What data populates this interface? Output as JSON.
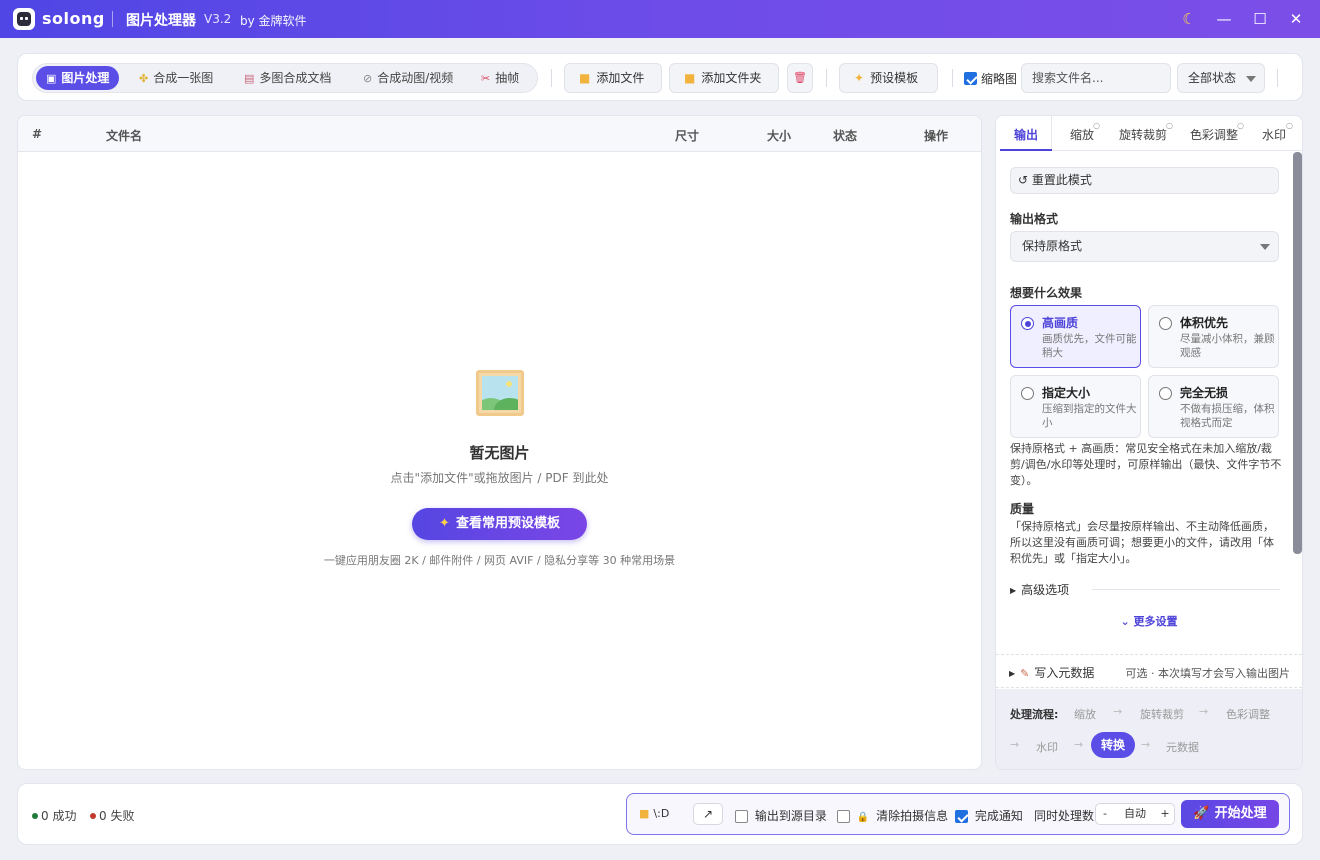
{
  "titlebar": {
    "app_name": "solong",
    "title": "图片处理器",
    "version": "V3.2",
    "by": "by 金牌软件",
    "theme_icon": "☾",
    "minimize_icon": "—",
    "maximize_icon": "☐",
    "close_icon": "✕"
  },
  "toolbar": {
    "mode_tabs": [
      {
        "label": "图片处理",
        "icon": "▣",
        "active": true
      },
      {
        "label": "合成一张图",
        "icon": "✤"
      },
      {
        "label": "多图合成文档",
        "icon": "▤"
      },
      {
        "label": "合成动图/视频",
        "icon": "⊘"
      },
      {
        "label": "抽帧",
        "icon": "✂"
      }
    ],
    "add_file": "添加文件",
    "add_folder": "添加文件夹",
    "delete_icon": "🗑",
    "folder_icon": "■",
    "preset_template": "预设模板",
    "preset_icon": "✦",
    "thumbnail_label": "缩略图",
    "thumbnail_checked": true,
    "search_placeholder": "搜索文件名...",
    "status_filter": "全部状态"
  },
  "table": {
    "columns": [
      "#",
      "文件名",
      "尺寸",
      "大小",
      "状态",
      "操作"
    ],
    "rows": [],
    "empty_title": "暂无图片",
    "empty_hint": "点击\"添加文件\"或拖放图片 / PDF 到此处",
    "preset_button": "查看常用预设模板",
    "preset_button_icon": "✦",
    "preset_sub": "一键应用朋友圈 2K / 邮件附件 / 网页 AVIF / 隐私分享等 30 种常用场景"
  },
  "side": {
    "tabs": [
      "输出",
      "缩放",
      "旋转裁剪",
      "色彩调整",
      "水印"
    ],
    "active_tab": "输出",
    "reset_label": "↺ 重置此模式",
    "output_format_label": "输出格式",
    "output_format_value": "保持原格式",
    "effect_label": "想要什么效果",
    "effects": [
      {
        "title": "高画质",
        "desc": "画质优先，文件可能稍大",
        "selected": true
      },
      {
        "title": "体积优先",
        "desc": "尽量减小体积，兼顾观感",
        "selected": false
      },
      {
        "title": "指定大小",
        "desc": "压缩到指定的文件大小",
        "selected": false
      },
      {
        "title": "完全无损",
        "desc": "不做有损压缩，体积视格式而定",
        "selected": false
      }
    ],
    "effect_note": "保持原格式 + 高画质：常见安全格式在未加入缩放/裁剪/调色/水印等处理时，可原样输出（最快、文件字节不变）。",
    "quality_label": "质量",
    "quality_note": "「保持原格式」会尽量按原样输出、不主动降低画质，所以这里没有画质可调；想要更小的文件，请改用「体积优先」或「指定大小」。",
    "advanced": "高级选项",
    "more_settings": "⌄ 更多设置",
    "metadata_title": "写入元数据",
    "metadata_hint": "可选 · 本次填写才会写入输出图片",
    "flow": {
      "label": "处理流程:",
      "steps_row1": [
        "缩放",
        "旋转裁剪",
        "色彩调整"
      ],
      "steps_row2": [
        "水印",
        "转换",
        "元数据"
      ],
      "current": "转换",
      "arrow": "→"
    }
  },
  "bottom": {
    "success": "0 成功",
    "fail": "0 失败",
    "success_color": "#1f7a3a",
    "fail_color": "#c0392b",
    "output_path": "\\:D",
    "open_icon": "↗",
    "output_to_source": "输出到源目录",
    "output_to_source_checked": false,
    "clear_exif": "清除拍摄信息",
    "clear_exif_checked": false,
    "lock_icon": "🔒",
    "notify": "完成通知",
    "notify_checked": true,
    "concurrency_label": "同时处理数",
    "concurrency_minus": "-",
    "concurrency_value": "自动",
    "concurrency_plus": "+",
    "start": "开始处理",
    "start_icon": "🚀"
  },
  "colors": {
    "accent": "#5b4ee6",
    "titlebar_start": "#4f46e5",
    "titlebar_end": "#7c4ee8"
  }
}
